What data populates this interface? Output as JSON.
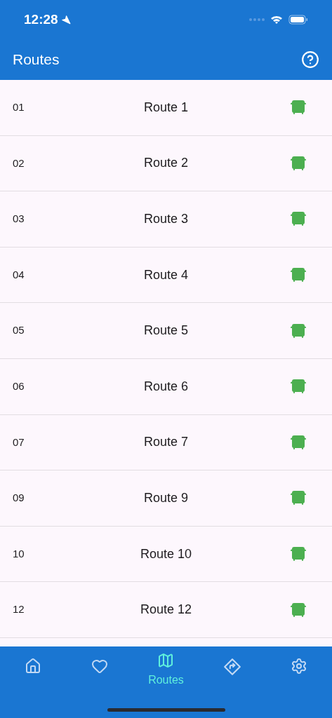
{
  "status_bar": {
    "time": "12:28"
  },
  "app_bar": {
    "title": "Routes"
  },
  "routes": [
    {
      "number": "01",
      "name": "Route 1"
    },
    {
      "number": "02",
      "name": "Route 2"
    },
    {
      "number": "03",
      "name": "Route 3"
    },
    {
      "number": "04",
      "name": "Route 4"
    },
    {
      "number": "05",
      "name": "Route 5"
    },
    {
      "number": "06",
      "name": "Route 6"
    },
    {
      "number": "07",
      "name": "Route 7"
    },
    {
      "number": "09",
      "name": "Route 9"
    },
    {
      "number": "10",
      "name": "Route 10"
    },
    {
      "number": "12",
      "name": "Route 12"
    }
  ],
  "nav": [
    {
      "kind": "home",
      "selected": false
    },
    {
      "kind": "favorites",
      "selected": false
    },
    {
      "kind": "routes",
      "selected": true,
      "label": "Routes"
    },
    {
      "kind": "directions",
      "selected": false
    },
    {
      "kind": "settings",
      "selected": false
    }
  ]
}
